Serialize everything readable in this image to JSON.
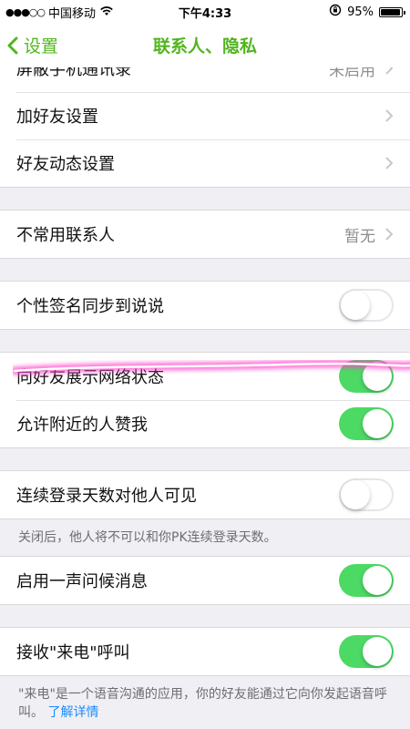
{
  "status_bar": {
    "signal_dots": "●●●○○",
    "carrier": "中国移动",
    "time": "下午4:33",
    "battery_percent": "95%",
    "battery_level": 0.95
  },
  "nav": {
    "back_label": "设置",
    "title": "联系人、隐私"
  },
  "rows": {
    "partial_top": {
      "label": "屏蔽手机通讯录",
      "value": "未启用"
    },
    "add_friend": {
      "label": "加好友设置"
    },
    "friend_feed": {
      "label": "好友动态设置"
    },
    "infrequent_contacts": {
      "label": "不常用联系人",
      "value": "暂无"
    },
    "signature_sync": {
      "label": "个性签名同步到说说",
      "state": "off"
    },
    "show_network_status": {
      "label": "向好友展示网络状态",
      "state": "on"
    },
    "nearby_likes": {
      "label": "允许附近的人赞我",
      "state": "on"
    },
    "login_days_visible": {
      "label": "连续登录天数对他人可见",
      "state": "off"
    },
    "greeting_message": {
      "label": "启用一声问候消息",
      "state": "on"
    },
    "receive_calls": {
      "label": "接收\"来电\"呼叫",
      "state": "on"
    }
  },
  "footnotes": {
    "login_days": "关闭后，他人将不可以和你PK连续登录天数。",
    "calls": "\"来电\"是一个语音沟通的应用，你的好友能通过它向你发起语音呼叫。",
    "calls_link": "了解详情"
  },
  "colors": {
    "accent": "#52b520",
    "switch_on": "#4cd964",
    "annotation": "#ff3cc8",
    "link": "#1a8cff"
  },
  "icons": {
    "back": "chevron-left-icon",
    "disclosure": "chevron-right-icon",
    "wifi": "wifi-icon",
    "lock_rotation": "rotation-lock-icon",
    "battery": "battery-icon"
  }
}
